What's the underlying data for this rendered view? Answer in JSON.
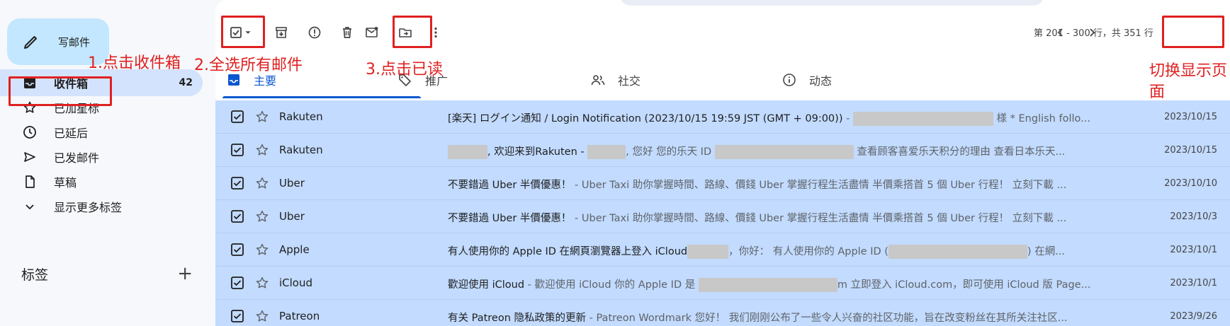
{
  "sidebar": {
    "compose_label": "写邮件",
    "items": [
      {
        "label": "收件箱",
        "count": "42",
        "icon": "inbox-icon"
      },
      {
        "label": "已加星标",
        "icon": "star-icon"
      },
      {
        "label": "已延后",
        "icon": "clock-icon"
      },
      {
        "label": "已发邮件",
        "icon": "send-icon"
      },
      {
        "label": "草稿",
        "icon": "draft-icon"
      },
      {
        "label": "显示更多标签",
        "icon": "chevron-down-icon"
      }
    ],
    "labels_title": "标签",
    "labels_add": "+"
  },
  "toolbar": {
    "pagination": "第 201 - 300 行，共 351 行"
  },
  "tabs": [
    {
      "label": "主要",
      "icon": "inbox-icon"
    },
    {
      "label": "推广",
      "icon": "tag-icon"
    },
    {
      "label": "社交",
      "icon": "people-icon"
    },
    {
      "label": "动态",
      "icon": "info-icon"
    }
  ],
  "emails": [
    {
      "sender": "Rakuten",
      "subject": "[楽天] ログイン通知 / Login Notification (2023/10/15 19:59 JST (GMT + 09:00))",
      "snippet": " - ",
      "snippet_tail": " 様  * English follo...",
      "date": "2023/10/15"
    },
    {
      "sender": "Rakuten",
      "subject": "",
      "snippet": ", 欢迎来到Rakuten - ",
      "snippet_mid": ", 您好 您的乐天 ID ",
      "snippet_tail": " 查看顾客喜爱乐天积分的理由 查看日本乐天...",
      "date": "2023/10/15"
    },
    {
      "sender": "Uber",
      "subject": "不要錯過 Uber 半價優惠！",
      "snippet": " - Uber Taxi 助你掌握時間、路線、價錢 Uber 掌握行程生活盡情 半價乘搭首 5 個 Uber 行程！ 立刻下載 ...",
      "date": "2023/10/10"
    },
    {
      "sender": "Uber",
      "subject": "不要錯過 Uber 半價優惠！",
      "snippet": " - Uber Taxi 助你掌握時間、路線、價錢 Uber 掌握行程生活盡情 半價乘搭首 5 個 Uber 行程！ 立刻下載 ...",
      "date": "2023/10/3"
    },
    {
      "sender": "Apple",
      "subject": "有人使用你的 Apple ID 在網頁瀏覽器上登入 iCloud",
      "snippet": "，你好： 有人使用你的 Apple ID (",
      "snippet_tail": ") 在網...",
      "date": "2023/10/1"
    },
    {
      "sender": "iCloud",
      "subject": "歡迎使用 iCloud",
      "snippet": " - 歡迎使用 iCloud 你的 Apple ID 是 ",
      "snippet_tail": "m 立即登入 iCloud.com，即可使用 iCloud 版 Page...",
      "date": "2023/10/1"
    },
    {
      "sender": "Patreon",
      "subject": "有关 Patreon 隐私政策的更新",
      "snippet": " - Patreon Wordmark 您好！ 我们刚刚公布了一些令人兴奋的社区功能，旨在改变粉丝在其所关注社区...",
      "date": "2023/9/26"
    }
  ],
  "annotations": {
    "step1": "1.点击收件箱",
    "step2": "2.全选所有邮件",
    "step3": "3.点击已读",
    "step4_line1": "切换显示页",
    "step4_line2": "面"
  },
  "colors": {
    "accent": "#0b57d0",
    "selected_row": "#c2dbff",
    "annotation": "#e02020"
  }
}
